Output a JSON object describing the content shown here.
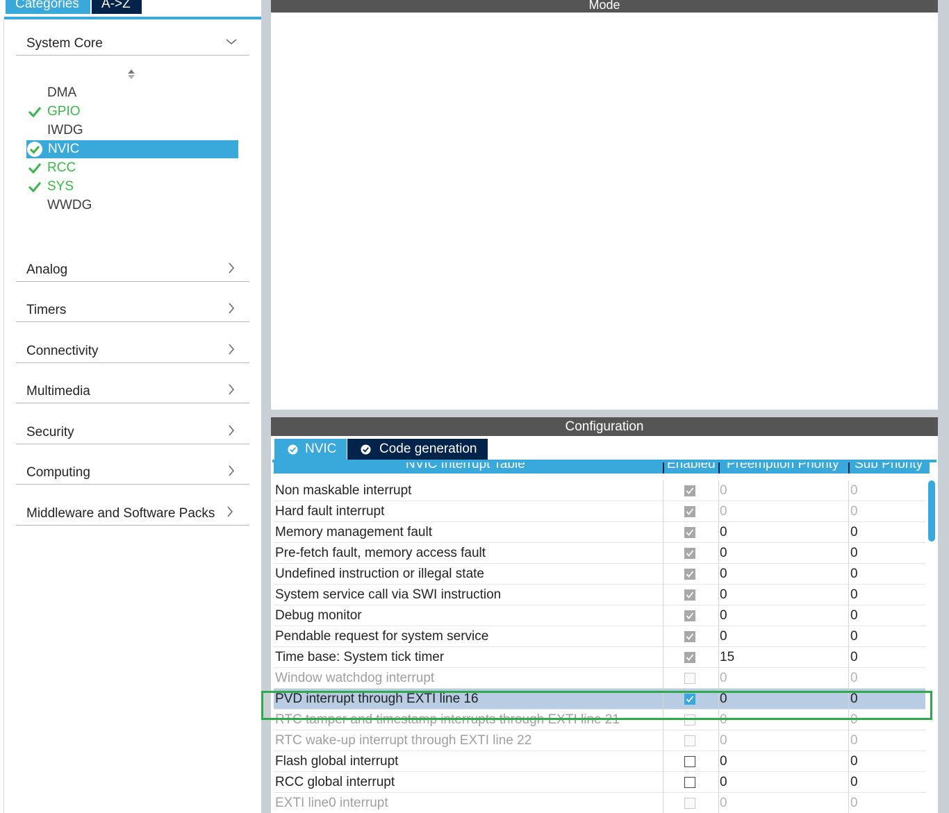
{
  "left": {
    "tabs": [
      "Categories",
      "A->Z"
    ],
    "expanded_category": "System Core",
    "peripherals": [
      {
        "name": "DMA",
        "status": "none"
      },
      {
        "name": "GPIO",
        "status": "ok"
      },
      {
        "name": "IWDG",
        "status": "none"
      },
      {
        "name": "NVIC",
        "status": "selected"
      },
      {
        "name": "RCC",
        "status": "ok"
      },
      {
        "name": "SYS",
        "status": "ok"
      },
      {
        "name": "WWDG",
        "status": "none"
      }
    ],
    "categories": [
      "Analog",
      "Timers",
      "Connectivity",
      "Multimedia",
      "Security",
      "Computing",
      "Middleware and Software Packs"
    ]
  },
  "mode_title": "Mode",
  "configuration": {
    "title": "Configuration",
    "tabs": [
      "NVIC",
      "Code generation"
    ],
    "table": {
      "headers": [
        "NVIC Interrupt Table",
        "Enabled",
        "Preemption Priority",
        "Sub Priority"
      ],
      "rows": [
        {
          "name": "Non maskable interrupt",
          "enabled": "grey",
          "preemption": "0",
          "sub": "0",
          "state": "fixed"
        },
        {
          "name": "Hard fault interrupt",
          "enabled": "grey",
          "preemption": "0",
          "sub": "0",
          "state": "fixed"
        },
        {
          "name": "Memory management fault",
          "enabled": "grey",
          "preemption": "0",
          "sub": "0",
          "state": "normal"
        },
        {
          "name": "Pre-fetch fault, memory access fault",
          "enabled": "grey",
          "preemption": "0",
          "sub": "0",
          "state": "normal"
        },
        {
          "name": "Undefined instruction or illegal state",
          "enabled": "grey",
          "preemption": "0",
          "sub": "0",
          "state": "normal"
        },
        {
          "name": "System service call via SWI instruction",
          "enabled": "grey",
          "preemption": "0",
          "sub": "0",
          "state": "normal"
        },
        {
          "name": "Debug monitor",
          "enabled": "grey",
          "preemption": "0",
          "sub": "0",
          "state": "normal"
        },
        {
          "name": "Pendable request for system service",
          "enabled": "grey",
          "preemption": "0",
          "sub": "0",
          "state": "normal"
        },
        {
          "name": "Time base: System tick timer",
          "enabled": "grey",
          "preemption": "15",
          "sub": "0",
          "state": "normal"
        },
        {
          "name": "Window watchdog interrupt",
          "enabled": "off-grey",
          "preemption": "0",
          "sub": "0",
          "state": "disabled"
        },
        {
          "name": "PVD interrupt through EXTI line 16",
          "enabled": "blue",
          "preemption": "0",
          "sub": "0",
          "state": "selected"
        },
        {
          "name": "RTC tamper and timestamp interrupts through EXTI line 21",
          "enabled": "off-grey",
          "preemption": "0",
          "sub": "0",
          "state": "disabled"
        },
        {
          "name": "RTC wake-up interrupt through EXTI line 22",
          "enabled": "off-grey",
          "preemption": "0",
          "sub": "0",
          "state": "disabled"
        },
        {
          "name": "Flash global interrupt",
          "enabled": "off",
          "preemption": "0",
          "sub": "0",
          "state": "normal"
        },
        {
          "name": "RCC global interrupt",
          "enabled": "off",
          "preemption": "0",
          "sub": "0",
          "state": "normal"
        },
        {
          "name": "EXTI line0 interrupt",
          "enabled": "off-grey",
          "preemption": "0",
          "sub": "0",
          "state": "disabled"
        }
      ]
    }
  },
  "colors": {
    "accent": "#39a9dc",
    "dark_tab": "#03234b",
    "ok_green": "#3cb54a",
    "highlight_green": "#2eaa4a",
    "selected_row": "#b8cce4"
  },
  "icons": {
    "chevron_down": "chevron-down-icon",
    "chevron_right": "chevron-right-icon",
    "check": "check-icon",
    "check_circle": "check-circle-icon",
    "sort": "sort-icon"
  }
}
